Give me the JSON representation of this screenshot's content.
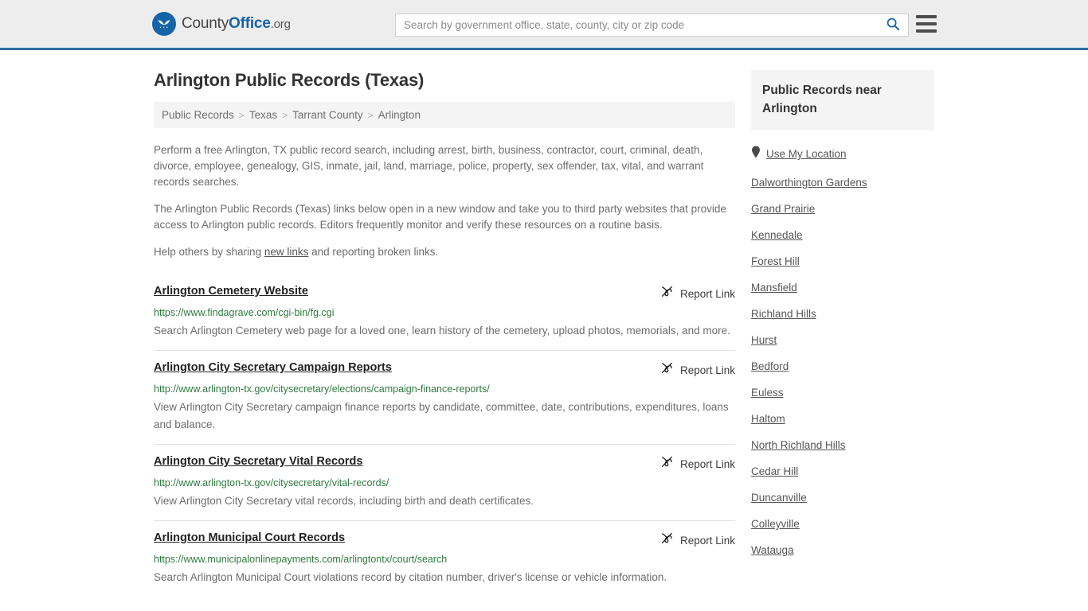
{
  "header": {
    "logo": {
      "part1": "County",
      "part2": "Office",
      "part3": ".org",
      "icon": "eagle-shield-logo-icon"
    },
    "search": {
      "placeholder": "Search by government office, state, county, city or zip code",
      "value": "",
      "button_icon": "search-icon"
    },
    "menu_icon": "hamburger-menu-icon",
    "accent_color": "#2e6da4"
  },
  "main": {
    "title": "Arlington Public Records (Texas)",
    "breadcrumb": [
      "Public Records",
      "Texas",
      "Tarrant County",
      "Arlington"
    ],
    "breadcrumb_separator": ">",
    "intro_paragraph_1": "Perform a free Arlington, TX public record search, including arrest, birth, business, contractor, court, criminal, death, divorce, employee, genealogy, GIS, inmate, jail, land, marriage, police, property, sex offender, tax, vital, and warrant records searches.",
    "intro_paragraph_2": "The Arlington Public Records (Texas) links below open in a new window and take you to third party websites that provide access to Arlington public records. Editors frequently monitor and verify these resources on a routine basis.",
    "help_prefix": "Help others by sharing ",
    "help_link": "new links",
    "help_suffix": " and reporting broken links.",
    "report_link_label": "Report Link",
    "report_link_icon": "broken-link-icon",
    "url_color": "#2f7a40",
    "results": [
      {
        "title": "Arlington Cemetery Website",
        "url": "https://www.findagrave.com/cgi-bin/fg.cgi",
        "description": "Search Arlington Cemetery web page for a loved one, learn history of the cemetery, upload photos, memorials, and more."
      },
      {
        "title": "Arlington City Secretary Campaign Reports",
        "url": "http://www.arlington-tx.gov/citysecretary/elections/campaign-finance-reports/",
        "description": "View Arlington City Secretary campaign finance reports by candidate, committee, date, contributions, expenditures, loans and balance."
      },
      {
        "title": "Arlington City Secretary Vital Records",
        "url": "http://www.arlington-tx.gov/citysecretary/vital-records/",
        "description": "View Arlington City Secretary vital records, including birth and death certificates."
      },
      {
        "title": "Arlington Municipal Court Records",
        "url": "https://www.municipalonlinepayments.com/arlingtontx/court/search",
        "description": "Search Arlington Municipal Court violations record by citation number, driver's license or vehicle information."
      }
    ]
  },
  "sidebar": {
    "title": "Public Records near Arlington",
    "use_my_location": {
      "label": "Use My Location",
      "icon": "map-pin-icon"
    },
    "nearby": [
      "Dalworthington Gardens",
      "Grand Prairie",
      "Kennedale",
      "Forest Hill",
      "Mansfield",
      "Richland Hills",
      "Hurst",
      "Bedford",
      "Euless",
      "Haltom",
      "North Richland Hills",
      "Cedar Hill",
      "Duncanville",
      "Colleyville",
      "Watauga"
    ]
  }
}
